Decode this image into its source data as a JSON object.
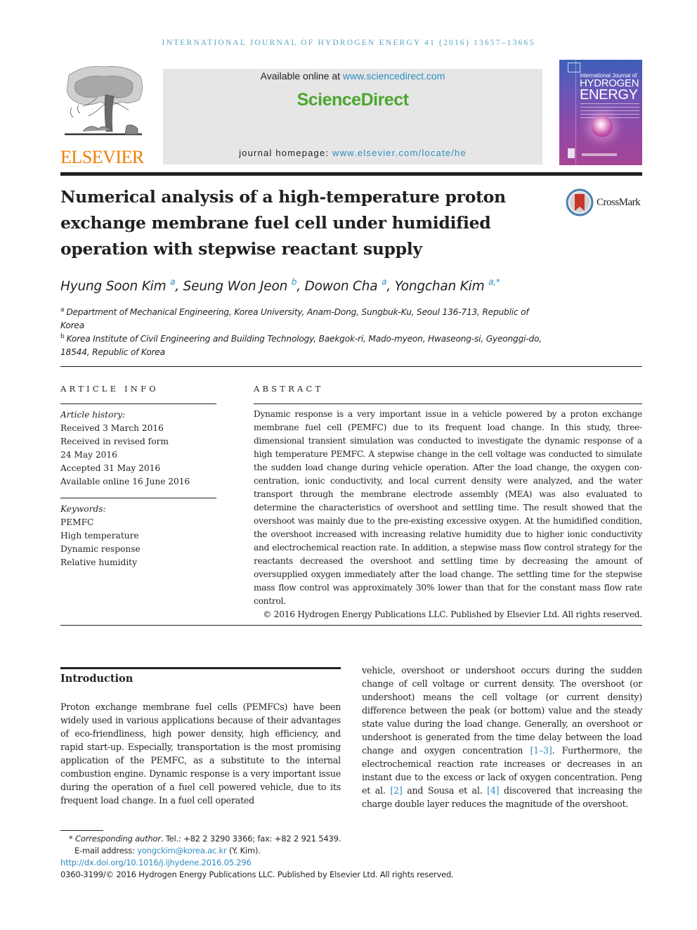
{
  "running_head": "INTERNATIONAL JOURNAL OF HYDROGEN ENERGY 41 (2016) 13657–13665",
  "masthead": {
    "publisher_logo_icon": "elsevier-tree-icon",
    "publisher_name": "ELSEVIER",
    "available_online_prefix": "Available online at ",
    "available_online_link": "www.sciencedirect.com",
    "sciencedirect_logo": "ScienceDirect",
    "homepage_prefix": "journal homepage: ",
    "homepage_link": "www.elsevier.com/locate/he",
    "cover": {
      "line1": "International Journal of",
      "line2": "HYDROGEN",
      "line3": "ENERGY"
    }
  },
  "article": {
    "title": "Numerical analysis of a high-temperature proton exchange membrane fuel cell under humidified operation with stepwise reactant supply",
    "crossmark_label": "CrossMark",
    "authors": [
      {
        "name": "Hyung Soon Kim",
        "sup": "a"
      },
      {
        "name": "Seung Won Jeon",
        "sup": "b"
      },
      {
        "name": "Dowon Cha",
        "sup": "a"
      },
      {
        "name": "Yongchan Kim",
        "sup": "a,*"
      }
    ],
    "affiliations": [
      {
        "mark": "a",
        "text": "Department of Mechanical Engineering, Korea University, Anam-Dong, Sungbuk-Ku, Seoul 136-713, Republic of Korea"
      },
      {
        "mark": "b",
        "text": "Korea Institute of Civil Engineering and Building Technology, Baekgok-ri, Mado-myeon, Hwaseong-si, Gyeonggi-do, 18544, Republic of Korea"
      }
    ]
  },
  "article_info": {
    "heading": "ARTICLE INFO",
    "history_label": "Article history:",
    "history": [
      "Received 3 March 2016",
      "Received in revised form",
      "24 May 2016",
      "Accepted 31 May 2016",
      "Available online 16 June 2016"
    ],
    "keywords_label": "Keywords:",
    "keywords": [
      "PEMFC",
      "High temperature",
      "Dynamic response",
      "Relative humidity"
    ]
  },
  "abstract": {
    "heading": "ABSTRACT",
    "text": "Dynamic response is a very important issue in a vehicle powered by a proton exchange membrane fuel cell (PEMFC) due to its frequent load change. In this study, three-dimensional transient simulation was conducted to investigate the dynamic response of a high temperature PEMFC. A stepwise change in the cell voltage was conducted to simulate the sudden load change during vehicle operation. After the load change, the oxygen con­centration, ionic conductivity, and local current density were analyzed, and the water transport through the membrane electrode assembly (MEA) was also evaluated to determine the characteristics of overshoot and settling time. The result showed that the overshoot was mainly due to the pre-existing excessive oxygen. At the humidified condition, the overshoot increased with increasing relative humidity due to higher ionic conductivity and electro­chemical reaction rate. In addition, a stepwise mass flow control strategy for the reactants decreased the overshoot and settling time by decreasing the amount of oversupplied oxygen immediately after the load change. The settling time for the stepwise mass flow control was approximately 30% lower than that for the constant mass flow rate control.",
    "copyright": "© 2016 Hydrogen Energy Publications LLC. Published by Elsevier Ltd. All rights reserved."
  },
  "introduction": {
    "heading": "Introduction",
    "left_text": "Proton exchange membrane fuel cells (PEMFCs) have been widely used in various applications because of their advan­tages of eco-friendliness, high power density, high efficiency, and rapid start-up. Especially, transportation is the most promising application of the PEMFC, as a substitute to the internal combustion engine. Dynamic response is a very important issue during the operation of a fuel cell powered vehicle, due to its frequent load change. In a fuel cell operated",
    "right_text_1": "vehicle, overshoot or undershoot occurs during the sudden change of cell voltage or current density. The overshoot (or undershoot) means the cell voltage (or current density) difference between the peak (or bottom) value and the steady state value during the load change. Generally, an overshoot or undershoot is generated from the time delay between the load change and oxygen concentration ",
    "ref_1": "[1–3]",
    "right_text_2": ". Furthermore, the electrochemical reaction rate increases or decreases in an instant due to the excess or lack of oxygen concentration. Peng et al. ",
    "ref_2": "[2]",
    "right_text_3": " and Sousa et al. ",
    "ref_3": "[4]",
    "right_text_4": " discovered that increasing the charge double layer reduces the magnitude of the overshoot."
  },
  "footnotes": {
    "star": "*",
    "corresponding_label": "Corresponding author",
    "contact": ". Tel.: +82 2 3290 3366; fax: +82 2 921 5439.",
    "email_label": "E-mail address: ",
    "email": "yongckim@korea.ac.kr",
    "email_suffix": " (Y. Kim).",
    "doi": "http://dx.doi.org/10.1016/j.ijhydene.2016.05.296",
    "issn_line": "0360-3199/© 2016 Hydrogen Energy Publications LLC. Published by Elsevier Ltd. All rights reserved."
  },
  "colors": {
    "link_blue": "#2e8cc0",
    "running_head": "#5aa5c4",
    "elsevier_orange": "#f07d00",
    "sciencedirect_green": "#4da72e",
    "masthead_gray": "#e6e6e6"
  }
}
